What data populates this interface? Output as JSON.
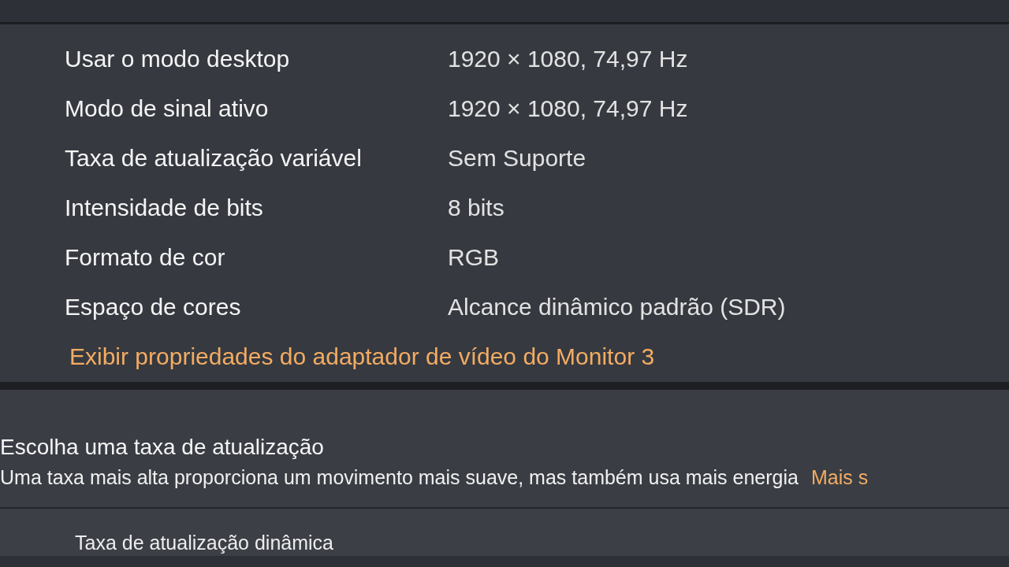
{
  "display_info": {
    "rows": [
      {
        "label": "Usar o modo desktop",
        "value": "1920 × 1080, 74,97 Hz"
      },
      {
        "label": "Modo de sinal ativo",
        "value": "1920 × 1080, 74,97 Hz"
      },
      {
        "label": "Taxa de atualização variável",
        "value": "Sem Suporte"
      },
      {
        "label": "Intensidade de bits",
        "value": "8 bits"
      },
      {
        "label": "Formato de cor",
        "value": "RGB"
      },
      {
        "label": "Espaço de cores",
        "value": "Alcance dinâmico padrão (SDR)"
      }
    ],
    "link": "Exibir propriedades do adaptador de vídeo do Monitor 3"
  },
  "refresh_rate": {
    "title": "Escolha uma taxa de atualização",
    "description": "Uma taxa mais alta proporciona um movimento mais suave, mas também usa mais energia",
    "link": "Mais s"
  },
  "dynamic_refresh": {
    "label": "Taxa de atualização dinâmica"
  }
}
